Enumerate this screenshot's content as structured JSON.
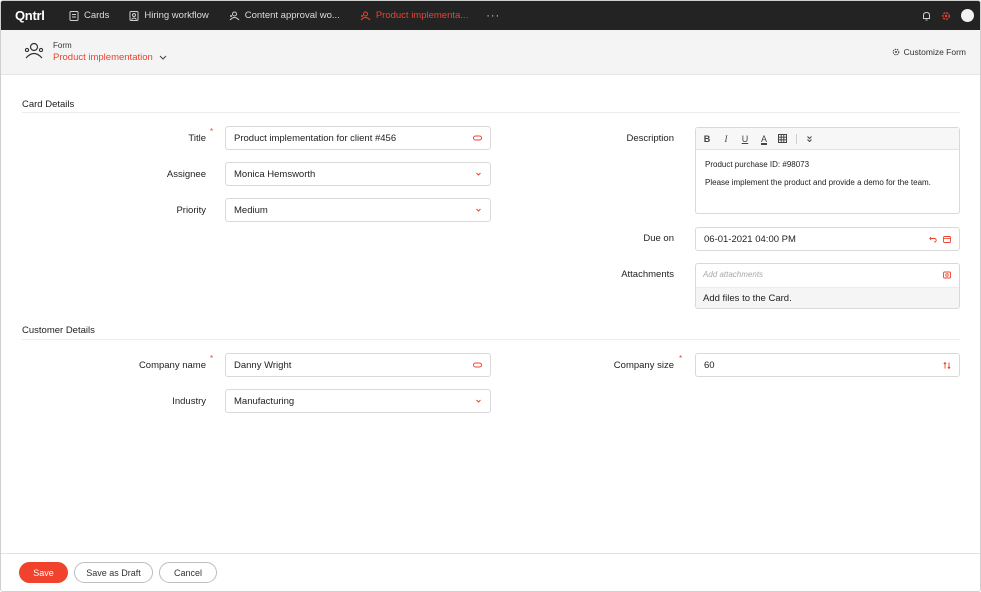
{
  "nav": {
    "logo": "Qntrl",
    "tabs": [
      {
        "label": "Cards",
        "icon": "cards-icon"
      },
      {
        "label": "Hiring workflow",
        "icon": "person-form-icon"
      },
      {
        "label": "Content approval wo...",
        "icon": "workflow-icon"
      },
      {
        "label": "Product implementa...",
        "icon": "workflow-icon",
        "active": true
      }
    ],
    "more": "···"
  },
  "header": {
    "type_label": "Form",
    "form_name": "Product implementation",
    "customize_label": "Customize Form"
  },
  "card_details": {
    "title": "Card Details",
    "fields": {
      "title": {
        "label": "Title",
        "value": "Product implementation for client #456"
      },
      "assignee": {
        "label": "Assignee",
        "value": "Monica Hemsworth"
      },
      "priority": {
        "label": "Priority",
        "value": "Medium"
      },
      "description": {
        "label": "Description",
        "toolbar": [
          "B",
          "I",
          "U",
          "A"
        ],
        "lines": [
          "Product purchase ID: #98073",
          "Please implement the product and provide a demo for the team."
        ]
      },
      "due_on": {
        "label": "Due on",
        "value": "06-01-2021 04:00 PM"
      },
      "attachments": {
        "label": "Attachments",
        "placeholder": "Add attachments",
        "hint": "Add files to the Card."
      }
    }
  },
  "customer_details": {
    "title": "Customer Details",
    "fields": {
      "company_name": {
        "label": "Company name",
        "value": "Danny Wright"
      },
      "industry": {
        "label": "Industry",
        "value": "Manufacturing"
      },
      "company_size": {
        "label": "Company size",
        "value": "60"
      }
    }
  },
  "footer": {
    "save": "Save",
    "save_draft": "Save as Draft",
    "cancel": "Cancel"
  },
  "colors": {
    "accent": "#f0422d",
    "topbar": "#232323"
  }
}
